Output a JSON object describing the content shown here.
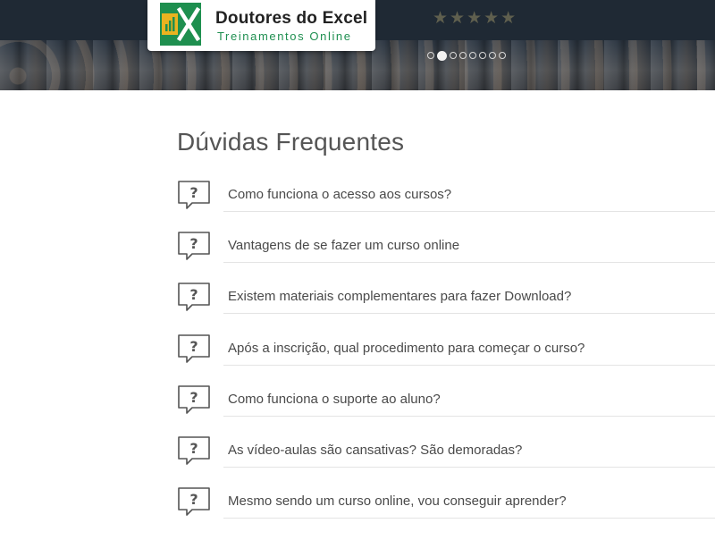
{
  "brand": {
    "title": "Doutores do Excel",
    "subtitle": "Treinamentos Online",
    "colors": {
      "green": "#1e8f4f",
      "gold": "#e9b320",
      "banner": "#1f2934"
    }
  },
  "banner": {
    "stars": "★★★★★",
    "slider_dots": 8,
    "active_dot": 2
  },
  "faq": {
    "title": "Dúvidas Frequentes",
    "icon": "question-speech-bubble-icon",
    "questions": [
      "Como funciona o acesso aos cursos?",
      "Vantagens de se fazer um curso online",
      "Existem materiais complementares para fazer Download?",
      "Após a inscrição, qual procedimento para começar o curso?",
      "Como funciona o suporte ao aluno?",
      "As vídeo-aulas são cansativas? São demoradas?",
      "Mesmo sendo um curso online, vou conseguir aprender?"
    ]
  }
}
